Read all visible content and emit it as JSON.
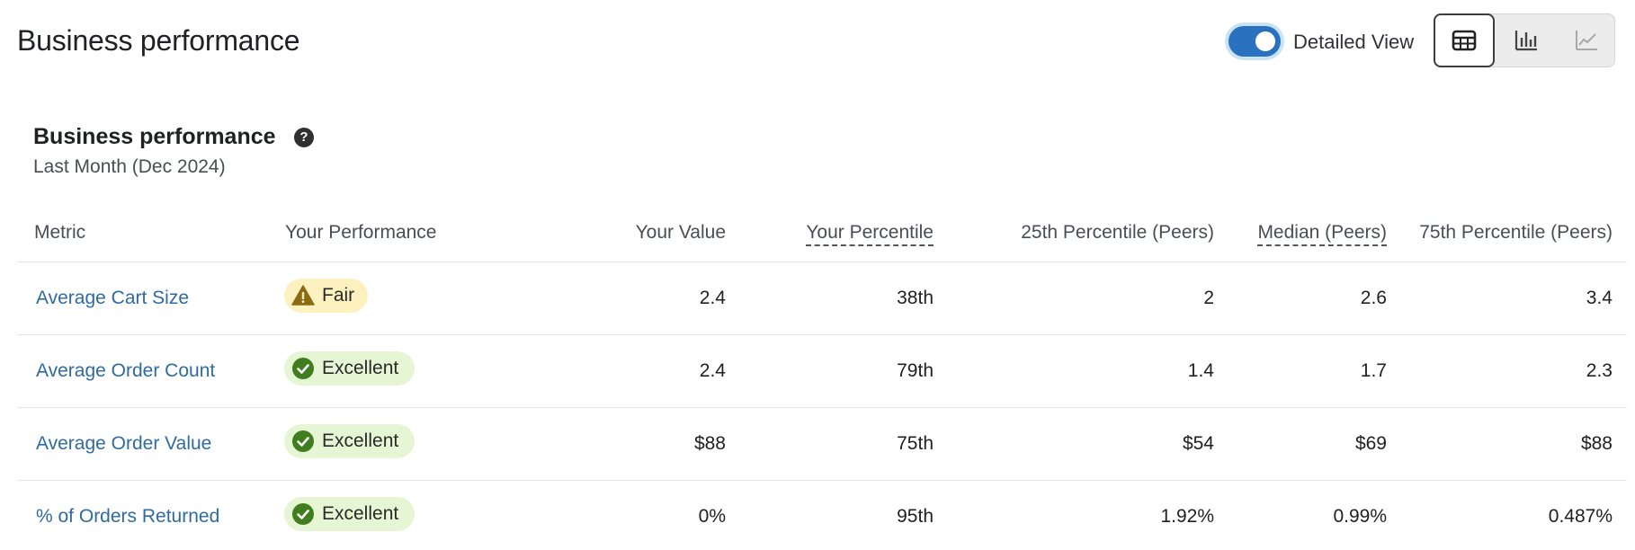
{
  "header": {
    "title": "Business performance",
    "toggle_label": "Detailed View",
    "toggle_on": true,
    "views": [
      {
        "icon": "table-icon",
        "active": true
      },
      {
        "icon": "bar-chart-icon",
        "active": false
      },
      {
        "icon": "line-chart-icon",
        "active": false
      }
    ]
  },
  "section": {
    "title": "Business performance",
    "help_glyph": "?",
    "subtitle": "Last Month (Dec 2024)"
  },
  "table": {
    "columns": [
      "Metric",
      "Your Performance",
      "Your Value",
      "Your Percentile",
      "25th Percentile (Peers)",
      "Median (Peers)",
      "75th Percentile (Peers)"
    ],
    "rows": [
      {
        "metric": "Average Cart Size",
        "performance": "Fair",
        "status": "fair",
        "value": "2.4",
        "percentile": "38th",
        "p25": "2",
        "median": "2.6",
        "p75": "3.4"
      },
      {
        "metric": "Average Order Count",
        "performance": "Excellent",
        "status": "excellent",
        "value": "2.4",
        "percentile": "79th",
        "p25": "1.4",
        "median": "1.7",
        "p75": "2.3"
      },
      {
        "metric": "Average Order Value",
        "performance": "Excellent",
        "status": "excellent",
        "value": "$88",
        "percentile": "75th",
        "p25": "$54",
        "median": "$69",
        "p75": "$88"
      },
      {
        "metric": "% of Orders Returned",
        "performance": "Excellent",
        "status": "excellent",
        "value": "0%",
        "percentile": "95th",
        "p25": "1.92%",
        "median": "0.99%",
        "p75": "0.487%"
      }
    ]
  },
  "colors": {
    "accent": "#2a71c0",
    "link": "#2f6aa3",
    "fair_bg": "#fdf2bf",
    "fair_icon": "#8a6a12",
    "excellent_bg": "#e6f5d3",
    "excellent_icon": "#3f7d1e"
  }
}
